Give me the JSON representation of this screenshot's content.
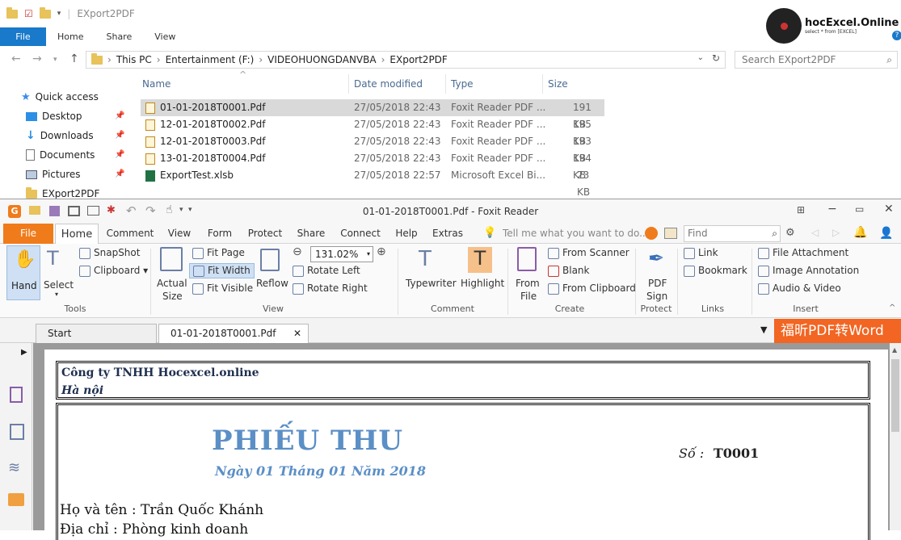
{
  "explorer": {
    "title": "EXport2PDF",
    "ribbon_tabs": [
      "File",
      "Home",
      "Share",
      "View"
    ],
    "breadcrumb": [
      "This PC",
      "Entertainment (F:)",
      "VIDEOHUONGDANVBA",
      "EXport2PDF"
    ],
    "search_placeholder": "Search EXport2PDF",
    "nav": [
      {
        "label": "Quick access",
        "icon": "star-icon"
      },
      {
        "label": "Desktop",
        "icon": "desktop-icon"
      },
      {
        "label": "Downloads",
        "icon": "download-icon"
      },
      {
        "label": "Documents",
        "icon": "documents-icon"
      },
      {
        "label": "Pictures",
        "icon": "pictures-icon"
      },
      {
        "label": "EXport2PDF",
        "icon": "folder-icon"
      }
    ],
    "columns": [
      "Name",
      "Date modified",
      "Type",
      "Size"
    ],
    "files": [
      {
        "name": "01-01-2018T0001.Pdf",
        "date": "27/05/2018 22:43",
        "type": "Foxit Reader PDF ...",
        "size": "191 KB",
        "icon": "pdf-file-icon"
      },
      {
        "name": "12-01-2018T0002.Pdf",
        "date": "27/05/2018 22:43",
        "type": "Foxit Reader PDF ...",
        "size": "195 KB",
        "icon": "pdf-file-icon"
      },
      {
        "name": "12-01-2018T0003.Pdf",
        "date": "27/05/2018 22:43",
        "type": "Foxit Reader PDF ...",
        "size": "193 KB",
        "icon": "pdf-file-icon"
      },
      {
        "name": "13-01-2018T0004.Pdf",
        "date": "27/05/2018 22:43",
        "type": "Foxit Reader PDF ...",
        "size": "194 KB",
        "icon": "pdf-file-icon"
      },
      {
        "name": "ExportTest.xlsb",
        "date": "27/05/2018 22:57",
        "type": "Microsoft Excel Bi...",
        "size": "23 KB",
        "icon": "excel-file-icon"
      }
    ],
    "logo": {
      "main": "hocExcel.Online",
      "sub": "select * from [EXCEL]"
    }
  },
  "foxit": {
    "title": "01-01-2018T0001.Pdf - Foxit Reader",
    "tabs": [
      "File",
      "Home",
      "Comment",
      "View",
      "Form",
      "Protect",
      "Share",
      "Connect",
      "Help",
      "Extras"
    ],
    "tell_me": "Tell me what you want to do...",
    "find_placeholder": "Find",
    "ribbon": {
      "hand": "Hand",
      "select": "Select",
      "snapshot": "SnapShot",
      "clipboard": "Clipboard",
      "tools_group": "Tools",
      "actual_size_1": "Actual",
      "actual_size_2": "Size",
      "fit_page": "Fit Page",
      "fit_width": "Fit Width",
      "fit_visible": "Fit Visible",
      "reflow": "Reflow",
      "zoom": "131.02%",
      "rotate_left": "Rotate Left",
      "rotate_right": "Rotate Right",
      "view_group": "View",
      "typewriter": "Typewriter",
      "highlight": "Highlight",
      "comment_group": "Comment",
      "from_file_1": "From",
      "from_file_2": "File",
      "from_scanner": "From Scanner",
      "blank": "Blank",
      "from_clipboard": "From Clipboard",
      "create_group": "Create",
      "pdf_sign_1": "PDF",
      "pdf_sign_2": "Sign",
      "protect_group": "Protect",
      "link": "Link",
      "bookmark": "Bookmark",
      "links_group": "Links",
      "file_attachment": "File Attachment",
      "image_annotation": "Image Annotation",
      "audio_video": "Audio & Video",
      "insert_group": "Insert"
    },
    "doc_tabs": [
      "Start",
      "01-01-2018T0001.Pdf"
    ],
    "promo": "福昕PDF转Word"
  },
  "document": {
    "company": "Công ty TNHH Hocexcel.online",
    "city": "Hà nội",
    "title": "PHIẾU THU",
    "date": "Ngày  01 Tháng 01 Năm 2018",
    "number_label": "Số :",
    "number": "T0001",
    "payer": "Họ và tên : Trần Quốc Khánh",
    "address": "Địa chỉ : Phòng kinh doanh"
  }
}
